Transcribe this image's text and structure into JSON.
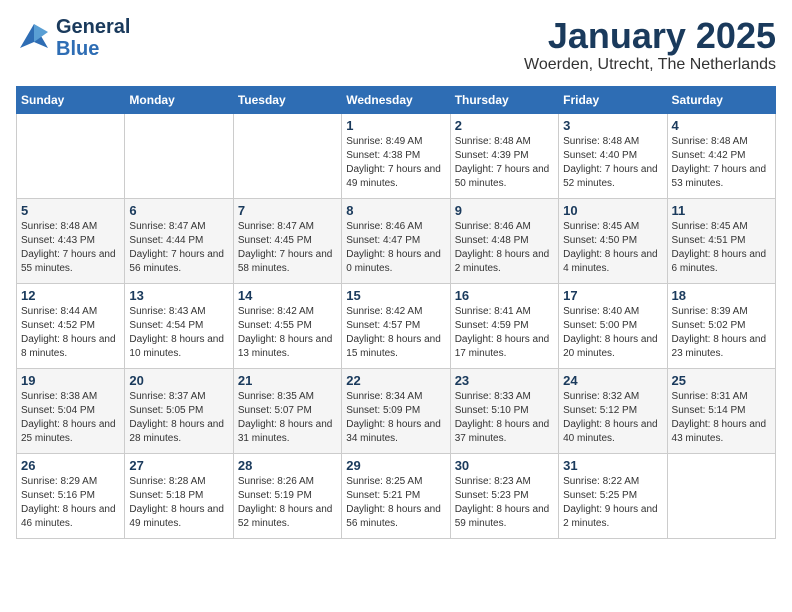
{
  "header": {
    "logo_general": "General",
    "logo_blue": "Blue",
    "month_title": "January 2025",
    "location": "Woerden, Utrecht, The Netherlands"
  },
  "weekdays": [
    "Sunday",
    "Monday",
    "Tuesday",
    "Wednesday",
    "Thursday",
    "Friday",
    "Saturday"
  ],
  "weeks": [
    [
      {
        "day": "",
        "sunrise": "",
        "sunset": "",
        "daylight": ""
      },
      {
        "day": "",
        "sunrise": "",
        "sunset": "",
        "daylight": ""
      },
      {
        "day": "",
        "sunrise": "",
        "sunset": "",
        "daylight": ""
      },
      {
        "day": "1",
        "sunrise": "Sunrise: 8:49 AM",
        "sunset": "Sunset: 4:38 PM",
        "daylight": "Daylight: 7 hours and 49 minutes."
      },
      {
        "day": "2",
        "sunrise": "Sunrise: 8:48 AM",
        "sunset": "Sunset: 4:39 PM",
        "daylight": "Daylight: 7 hours and 50 minutes."
      },
      {
        "day": "3",
        "sunrise": "Sunrise: 8:48 AM",
        "sunset": "Sunset: 4:40 PM",
        "daylight": "Daylight: 7 hours and 52 minutes."
      },
      {
        "day": "4",
        "sunrise": "Sunrise: 8:48 AM",
        "sunset": "Sunset: 4:42 PM",
        "daylight": "Daylight: 7 hours and 53 minutes."
      }
    ],
    [
      {
        "day": "5",
        "sunrise": "Sunrise: 8:48 AM",
        "sunset": "Sunset: 4:43 PM",
        "daylight": "Daylight: 7 hours and 55 minutes."
      },
      {
        "day": "6",
        "sunrise": "Sunrise: 8:47 AM",
        "sunset": "Sunset: 4:44 PM",
        "daylight": "Daylight: 7 hours and 56 minutes."
      },
      {
        "day": "7",
        "sunrise": "Sunrise: 8:47 AM",
        "sunset": "Sunset: 4:45 PM",
        "daylight": "Daylight: 7 hours and 58 minutes."
      },
      {
        "day": "8",
        "sunrise": "Sunrise: 8:46 AM",
        "sunset": "Sunset: 4:47 PM",
        "daylight": "Daylight: 8 hours and 0 minutes."
      },
      {
        "day": "9",
        "sunrise": "Sunrise: 8:46 AM",
        "sunset": "Sunset: 4:48 PM",
        "daylight": "Daylight: 8 hours and 2 minutes."
      },
      {
        "day": "10",
        "sunrise": "Sunrise: 8:45 AM",
        "sunset": "Sunset: 4:50 PM",
        "daylight": "Daylight: 8 hours and 4 minutes."
      },
      {
        "day": "11",
        "sunrise": "Sunrise: 8:45 AM",
        "sunset": "Sunset: 4:51 PM",
        "daylight": "Daylight: 8 hours and 6 minutes."
      }
    ],
    [
      {
        "day": "12",
        "sunrise": "Sunrise: 8:44 AM",
        "sunset": "Sunset: 4:52 PM",
        "daylight": "Daylight: 8 hours and 8 minutes."
      },
      {
        "day": "13",
        "sunrise": "Sunrise: 8:43 AM",
        "sunset": "Sunset: 4:54 PM",
        "daylight": "Daylight: 8 hours and 10 minutes."
      },
      {
        "day": "14",
        "sunrise": "Sunrise: 8:42 AM",
        "sunset": "Sunset: 4:55 PM",
        "daylight": "Daylight: 8 hours and 13 minutes."
      },
      {
        "day": "15",
        "sunrise": "Sunrise: 8:42 AM",
        "sunset": "Sunset: 4:57 PM",
        "daylight": "Daylight: 8 hours and 15 minutes."
      },
      {
        "day": "16",
        "sunrise": "Sunrise: 8:41 AM",
        "sunset": "Sunset: 4:59 PM",
        "daylight": "Daylight: 8 hours and 17 minutes."
      },
      {
        "day": "17",
        "sunrise": "Sunrise: 8:40 AM",
        "sunset": "Sunset: 5:00 PM",
        "daylight": "Daylight: 8 hours and 20 minutes."
      },
      {
        "day": "18",
        "sunrise": "Sunrise: 8:39 AM",
        "sunset": "Sunset: 5:02 PM",
        "daylight": "Daylight: 8 hours and 23 minutes."
      }
    ],
    [
      {
        "day": "19",
        "sunrise": "Sunrise: 8:38 AM",
        "sunset": "Sunset: 5:04 PM",
        "daylight": "Daylight: 8 hours and 25 minutes."
      },
      {
        "day": "20",
        "sunrise": "Sunrise: 8:37 AM",
        "sunset": "Sunset: 5:05 PM",
        "daylight": "Daylight: 8 hours and 28 minutes."
      },
      {
        "day": "21",
        "sunrise": "Sunrise: 8:35 AM",
        "sunset": "Sunset: 5:07 PM",
        "daylight": "Daylight: 8 hours and 31 minutes."
      },
      {
        "day": "22",
        "sunrise": "Sunrise: 8:34 AM",
        "sunset": "Sunset: 5:09 PM",
        "daylight": "Daylight: 8 hours and 34 minutes."
      },
      {
        "day": "23",
        "sunrise": "Sunrise: 8:33 AM",
        "sunset": "Sunset: 5:10 PM",
        "daylight": "Daylight: 8 hours and 37 minutes."
      },
      {
        "day": "24",
        "sunrise": "Sunrise: 8:32 AM",
        "sunset": "Sunset: 5:12 PM",
        "daylight": "Daylight: 8 hours and 40 minutes."
      },
      {
        "day": "25",
        "sunrise": "Sunrise: 8:31 AM",
        "sunset": "Sunset: 5:14 PM",
        "daylight": "Daylight: 8 hours and 43 minutes."
      }
    ],
    [
      {
        "day": "26",
        "sunrise": "Sunrise: 8:29 AM",
        "sunset": "Sunset: 5:16 PM",
        "daylight": "Daylight: 8 hours and 46 minutes."
      },
      {
        "day": "27",
        "sunrise": "Sunrise: 8:28 AM",
        "sunset": "Sunset: 5:18 PM",
        "daylight": "Daylight: 8 hours and 49 minutes."
      },
      {
        "day": "28",
        "sunrise": "Sunrise: 8:26 AM",
        "sunset": "Sunset: 5:19 PM",
        "daylight": "Daylight: 8 hours and 52 minutes."
      },
      {
        "day": "29",
        "sunrise": "Sunrise: 8:25 AM",
        "sunset": "Sunset: 5:21 PM",
        "daylight": "Daylight: 8 hours and 56 minutes."
      },
      {
        "day": "30",
        "sunrise": "Sunrise: 8:23 AM",
        "sunset": "Sunset: 5:23 PM",
        "daylight": "Daylight: 8 hours and 59 minutes."
      },
      {
        "day": "31",
        "sunrise": "Sunrise: 8:22 AM",
        "sunset": "Sunset: 5:25 PM",
        "daylight": "Daylight: 9 hours and 2 minutes."
      },
      {
        "day": "",
        "sunrise": "",
        "sunset": "",
        "daylight": ""
      }
    ]
  ]
}
